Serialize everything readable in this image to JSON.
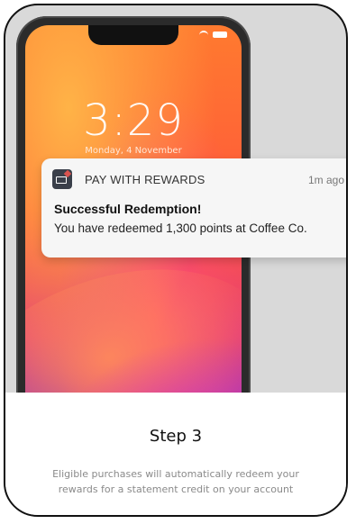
{
  "lockscreen": {
    "time": "3:29",
    "date": "Monday, 4 November"
  },
  "notification": {
    "app_icon": "rewards-card-icon",
    "app_name": "PAY WITH REWARDS",
    "time_ago": "1m ago",
    "title": "Successful Redemption!",
    "body": "You have redeemed 1,300 points at Coffee Co."
  },
  "step": {
    "title": "Step 3",
    "description": "Eligible purchases will automatically redeem your rewards for a statement credit on your account"
  },
  "colors": {
    "notification_bg": "#f6f6f6",
    "app_icon_bg": "#3a3f4a",
    "app_icon_accent": "#d9534f",
    "description_text": "#8a8a8a"
  }
}
